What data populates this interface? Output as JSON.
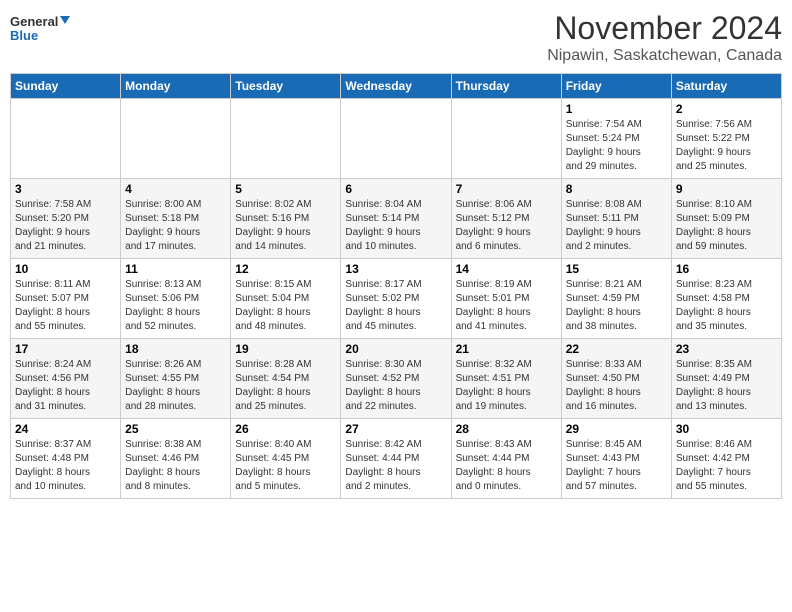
{
  "header": {
    "logo_line1": "General",
    "logo_line2": "Blue",
    "month_title": "November 2024",
    "location": "Nipawin, Saskatchewan, Canada"
  },
  "days_of_week": [
    "Sunday",
    "Monday",
    "Tuesday",
    "Wednesday",
    "Thursday",
    "Friday",
    "Saturday"
  ],
  "weeks": [
    [
      {
        "num": "",
        "info": ""
      },
      {
        "num": "",
        "info": ""
      },
      {
        "num": "",
        "info": ""
      },
      {
        "num": "",
        "info": ""
      },
      {
        "num": "",
        "info": ""
      },
      {
        "num": "1",
        "info": "Sunrise: 7:54 AM\nSunset: 5:24 PM\nDaylight: 9 hours\nand 29 minutes."
      },
      {
        "num": "2",
        "info": "Sunrise: 7:56 AM\nSunset: 5:22 PM\nDaylight: 9 hours\nand 25 minutes."
      }
    ],
    [
      {
        "num": "3",
        "info": "Sunrise: 7:58 AM\nSunset: 5:20 PM\nDaylight: 9 hours\nand 21 minutes."
      },
      {
        "num": "4",
        "info": "Sunrise: 8:00 AM\nSunset: 5:18 PM\nDaylight: 9 hours\nand 17 minutes."
      },
      {
        "num": "5",
        "info": "Sunrise: 8:02 AM\nSunset: 5:16 PM\nDaylight: 9 hours\nand 14 minutes."
      },
      {
        "num": "6",
        "info": "Sunrise: 8:04 AM\nSunset: 5:14 PM\nDaylight: 9 hours\nand 10 minutes."
      },
      {
        "num": "7",
        "info": "Sunrise: 8:06 AM\nSunset: 5:12 PM\nDaylight: 9 hours\nand 6 minutes."
      },
      {
        "num": "8",
        "info": "Sunrise: 8:08 AM\nSunset: 5:11 PM\nDaylight: 9 hours\nand 2 minutes."
      },
      {
        "num": "9",
        "info": "Sunrise: 8:10 AM\nSunset: 5:09 PM\nDaylight: 8 hours\nand 59 minutes."
      }
    ],
    [
      {
        "num": "10",
        "info": "Sunrise: 8:11 AM\nSunset: 5:07 PM\nDaylight: 8 hours\nand 55 minutes."
      },
      {
        "num": "11",
        "info": "Sunrise: 8:13 AM\nSunset: 5:06 PM\nDaylight: 8 hours\nand 52 minutes."
      },
      {
        "num": "12",
        "info": "Sunrise: 8:15 AM\nSunset: 5:04 PM\nDaylight: 8 hours\nand 48 minutes."
      },
      {
        "num": "13",
        "info": "Sunrise: 8:17 AM\nSunset: 5:02 PM\nDaylight: 8 hours\nand 45 minutes."
      },
      {
        "num": "14",
        "info": "Sunrise: 8:19 AM\nSunset: 5:01 PM\nDaylight: 8 hours\nand 41 minutes."
      },
      {
        "num": "15",
        "info": "Sunrise: 8:21 AM\nSunset: 4:59 PM\nDaylight: 8 hours\nand 38 minutes."
      },
      {
        "num": "16",
        "info": "Sunrise: 8:23 AM\nSunset: 4:58 PM\nDaylight: 8 hours\nand 35 minutes."
      }
    ],
    [
      {
        "num": "17",
        "info": "Sunrise: 8:24 AM\nSunset: 4:56 PM\nDaylight: 8 hours\nand 31 minutes."
      },
      {
        "num": "18",
        "info": "Sunrise: 8:26 AM\nSunset: 4:55 PM\nDaylight: 8 hours\nand 28 minutes."
      },
      {
        "num": "19",
        "info": "Sunrise: 8:28 AM\nSunset: 4:54 PM\nDaylight: 8 hours\nand 25 minutes."
      },
      {
        "num": "20",
        "info": "Sunrise: 8:30 AM\nSunset: 4:52 PM\nDaylight: 8 hours\nand 22 minutes."
      },
      {
        "num": "21",
        "info": "Sunrise: 8:32 AM\nSunset: 4:51 PM\nDaylight: 8 hours\nand 19 minutes."
      },
      {
        "num": "22",
        "info": "Sunrise: 8:33 AM\nSunset: 4:50 PM\nDaylight: 8 hours\nand 16 minutes."
      },
      {
        "num": "23",
        "info": "Sunrise: 8:35 AM\nSunset: 4:49 PM\nDaylight: 8 hours\nand 13 minutes."
      }
    ],
    [
      {
        "num": "24",
        "info": "Sunrise: 8:37 AM\nSunset: 4:48 PM\nDaylight: 8 hours\nand 10 minutes."
      },
      {
        "num": "25",
        "info": "Sunrise: 8:38 AM\nSunset: 4:46 PM\nDaylight: 8 hours\nand 8 minutes."
      },
      {
        "num": "26",
        "info": "Sunrise: 8:40 AM\nSunset: 4:45 PM\nDaylight: 8 hours\nand 5 minutes."
      },
      {
        "num": "27",
        "info": "Sunrise: 8:42 AM\nSunset: 4:44 PM\nDaylight: 8 hours\nand 2 minutes."
      },
      {
        "num": "28",
        "info": "Sunrise: 8:43 AM\nSunset: 4:44 PM\nDaylight: 8 hours\nand 0 minutes."
      },
      {
        "num": "29",
        "info": "Sunrise: 8:45 AM\nSunset: 4:43 PM\nDaylight: 7 hours\nand 57 minutes."
      },
      {
        "num": "30",
        "info": "Sunrise: 8:46 AM\nSunset: 4:42 PM\nDaylight: 7 hours\nand 55 minutes."
      }
    ]
  ]
}
